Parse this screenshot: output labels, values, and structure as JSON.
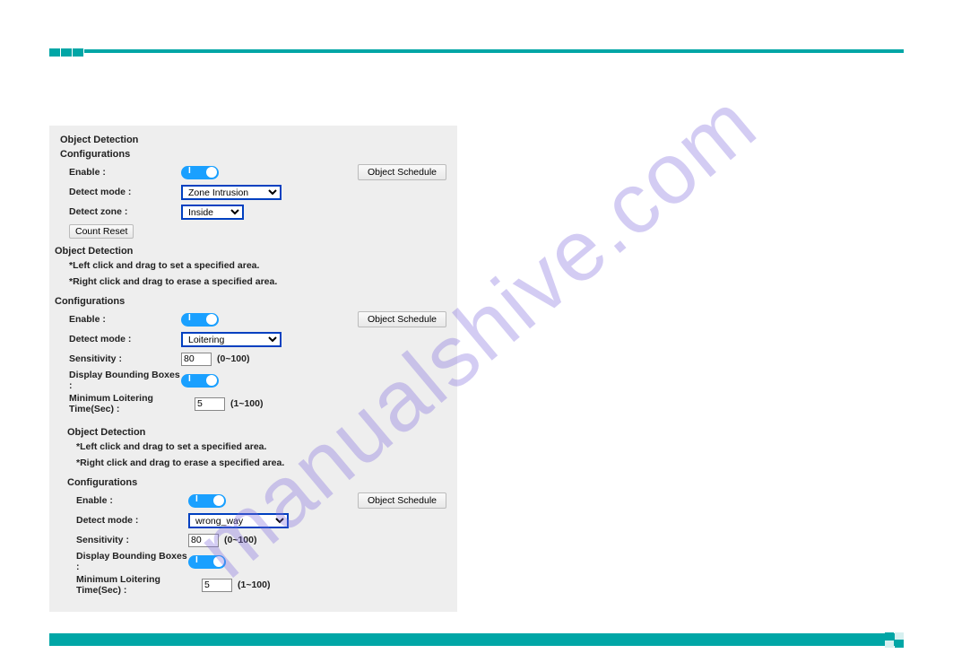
{
  "watermark": "manualshive.com",
  "section1": {
    "title_detect": "Object Detection",
    "title_conf": "Configurations",
    "enable_label": "Enable :",
    "schedule_btn": "Object Schedule",
    "detect_mode_label": "Detect mode :",
    "detect_mode_value": "Zone Intrusion",
    "detect_zone_label": "Detect zone :",
    "detect_zone_value": "Inside",
    "count_reset_btn": "Count Reset"
  },
  "detect_help": {
    "title": "Object Detection",
    "note1": "*Left click and drag to set a specified area.",
    "note2": "*Right click and drag to erase a specified area."
  },
  "section2": {
    "title_conf": "Configurations",
    "enable_label": "Enable :",
    "schedule_btn": "Object Schedule",
    "detect_mode_label": "Detect mode :",
    "detect_mode_value": "Loitering",
    "sensitivity_label": "Sensitivity :",
    "sensitivity_value": "80",
    "sensitivity_hint": "(0~100)",
    "bbox_label": "Display Bounding Boxes :",
    "minloiter_label": "Minimum Loitering Time(Sec) :",
    "minloiter_value": "5",
    "minloiter_hint": "(1~100)"
  },
  "section3": {
    "title_detect": "Object Detection",
    "note1": "*Left click and drag to set a specified area.",
    "note2": "*Right click and drag to erase a specified area.",
    "title_conf": "Configurations",
    "enable_label": "Enable :",
    "schedule_btn": "Object Schedule",
    "detect_mode_label": "Detect mode :",
    "detect_mode_value": "wrong_way",
    "sensitivity_label": "Sensitivity :",
    "sensitivity_value": "80",
    "sensitivity_hint": "(0~100)",
    "bbox_label": "Display Bounding Boxes :",
    "minloiter_label": "Minimum Loitering Time(Sec) :",
    "minloiter_value": "5",
    "minloiter_hint": "(1~100)"
  },
  "colors": {
    "accent": "#00a6a6",
    "toggle": "#1aa0ff",
    "select_border": "#0040c0",
    "watermark": "rgba(130,110,220,0.35)"
  }
}
